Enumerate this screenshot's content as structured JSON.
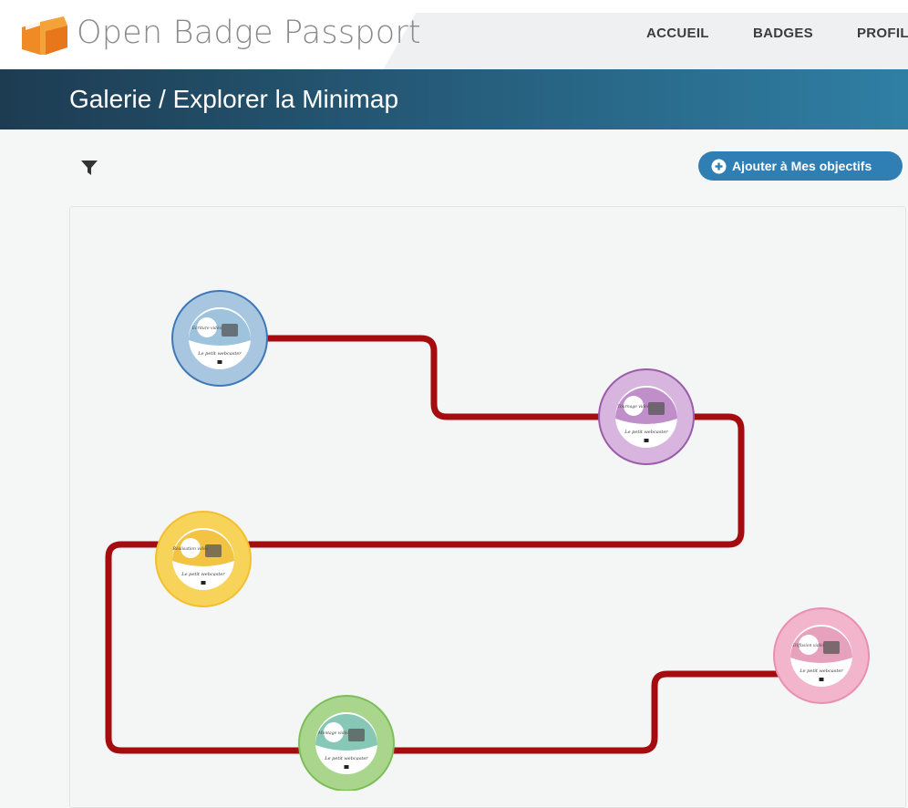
{
  "header": {
    "brand": "Open Badge Passport",
    "nav": {
      "accueil": "ACCUEIL",
      "badges": "BADGES",
      "profil": "PROFIL"
    }
  },
  "title_bar": {
    "title": "Galerie / Explorer la Minimap"
  },
  "toolbar": {
    "filter_icon": "filter-icon",
    "add_button_label": "Ajouter à Mes objectifs",
    "add_button_icon": "plus-circle-icon"
  },
  "minimap": {
    "path_color": "#a50c10",
    "badges": [
      {
        "id": "badge-1",
        "ring_color": "#a9c6e0",
        "border_color": "#3d78b8",
        "inner_color": "#9ec3dc",
        "label_top": "Ecriture vidéo",
        "label_bottom": "Le petit webcaster"
      },
      {
        "id": "badge-2",
        "ring_color": "#d7b5de",
        "border_color": "#9b5caa",
        "inner_color": "#c08fca",
        "label_top": "Tournage vidéo",
        "label_bottom": "Le petit webcaster"
      },
      {
        "id": "badge-3",
        "ring_color": "#f8d35a",
        "border_color": "#f2c02e",
        "inner_color": "#f3c444",
        "label_top": "Réalisation vidéo",
        "label_bottom": "Le petit webcaster"
      },
      {
        "id": "badge-4",
        "ring_color": "#a9d68c",
        "border_color": "#7cbf5a",
        "inner_color": "#86c7b6",
        "label_top": "Montage vidéo",
        "label_bottom": "Le petit webcaster"
      },
      {
        "id": "badge-5",
        "ring_color": "#f2b5cc",
        "border_color": "#e98fb2",
        "inner_color": "#e6a2bd",
        "label_top": "Diffusion vidéo",
        "label_bottom": "Le petit webcaster"
      }
    ]
  }
}
